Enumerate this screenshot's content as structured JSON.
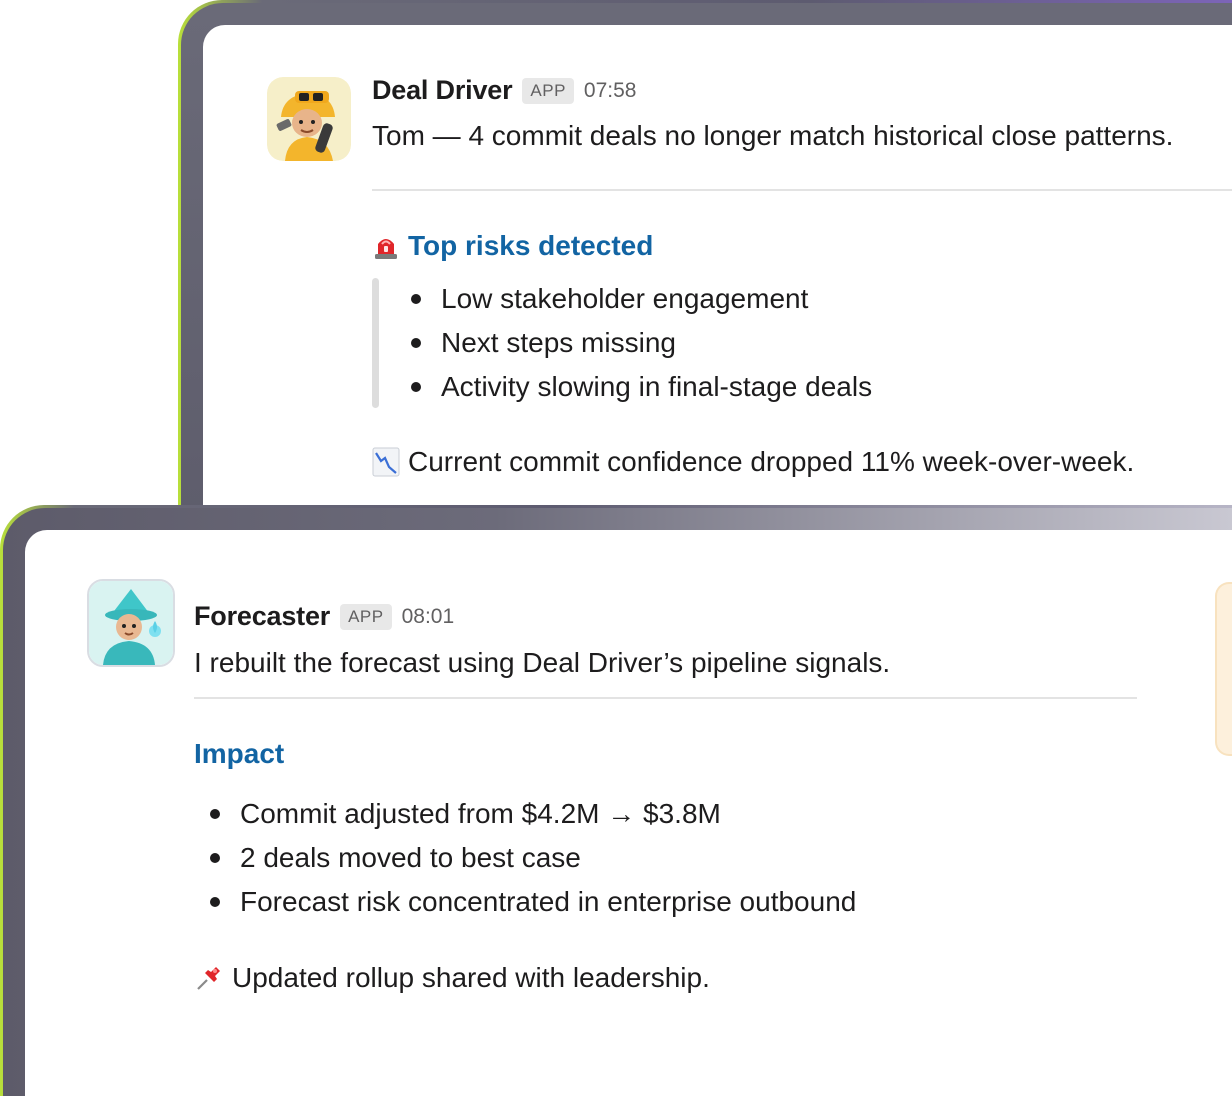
{
  "deal_driver": {
    "sender": "Deal Driver",
    "badge": "APP",
    "time": "07:58",
    "avatar_icon": "construction-worker-avatar-icon",
    "message": "Tom — 4 commit deals no longer match historical close patterns.",
    "section_title": "Top risks detected",
    "section_icon": "siren-icon",
    "risks": [
      "Low stakeholder engagement",
      "Next steps missing",
      "Activity slowing in final-stage deals"
    ],
    "footer_icon": "chart-decreasing-icon",
    "footer": "Current commit confidence dropped 11% week-over-week."
  },
  "forecaster": {
    "sender": "Forecaster",
    "badge": "APP",
    "time": "08:01",
    "avatar_icon": "wizard-avatar-icon",
    "message": "I rebuilt the forecast using Deal Driver’s pipeline signals.",
    "section_title": "Impact",
    "impacts": [
      "Commit adjusted from $4.2M → $3.8M",
      "2 deals moved to best case",
      "Forecast risk concentrated in enterprise outbound"
    ],
    "footer_icon": "pushpin-icon",
    "footer": "Updated rollup shared with leadership."
  },
  "colors": {
    "link_blue": "#1264a3",
    "frame_accent_green": "#b9e03a",
    "frame_accent_purple": "#7c64b8",
    "side_card": "#fdf0dc"
  }
}
